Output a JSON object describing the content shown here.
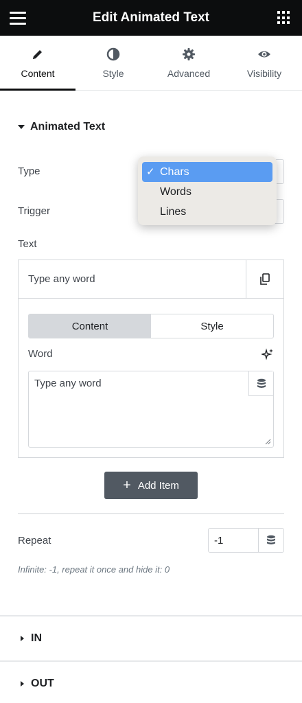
{
  "header": {
    "title": "Edit Animated Text"
  },
  "tabs": [
    {
      "label": "Content",
      "active": true
    },
    {
      "label": "Style"
    },
    {
      "label": "Advanced"
    },
    {
      "label": "Visibility"
    }
  ],
  "section": {
    "title": "Animated Text"
  },
  "fields": {
    "type_label": "Type",
    "trigger_label": "Trigger",
    "text_label": "Text"
  },
  "dropdown": {
    "options": [
      "Chars",
      "Words",
      "Lines"
    ],
    "selected": "Chars",
    "check": "✓"
  },
  "repeater": {
    "item_title": "Type any word",
    "segments": [
      "Content",
      "Style"
    ],
    "word_label": "Word",
    "word_value": "Type any word",
    "add_label": "Add Item"
  },
  "repeat": {
    "label": "Repeat",
    "value": "-1",
    "hint": "Infinite: -1, repeat it once and hide it: 0"
  },
  "collapsed_sections": [
    "IN",
    "OUT"
  ],
  "colors": {
    "topbar": "#0c0d0e",
    "selected_option": "#5a9cf2",
    "add_button": "#515962"
  }
}
